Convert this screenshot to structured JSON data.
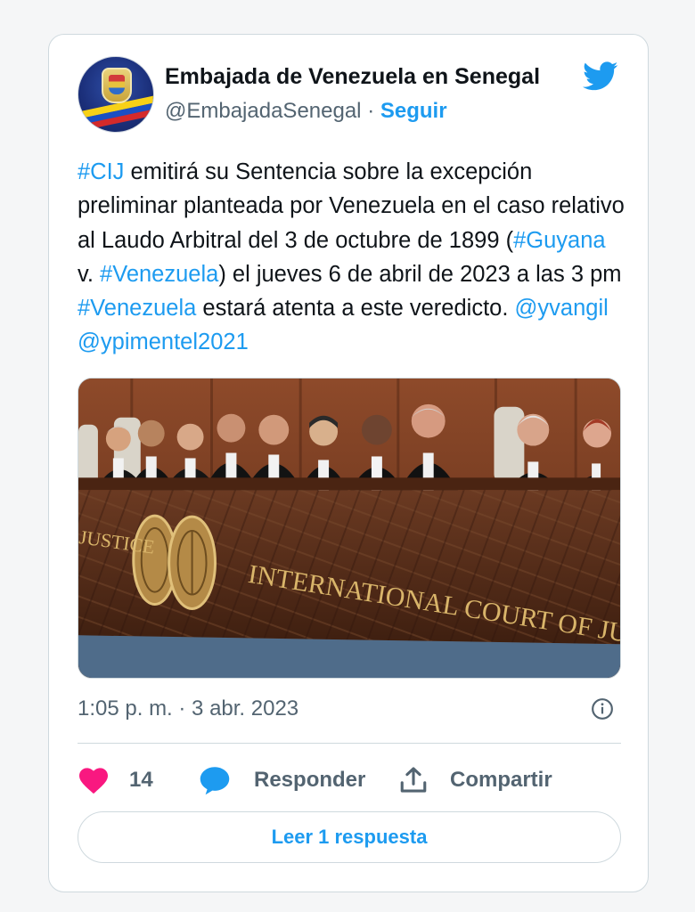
{
  "author": {
    "name": "Embajada de Venezuela en Senegal",
    "handle": "@EmbajadaSenegal",
    "separator": "·",
    "follow_label": "Seguir"
  },
  "tweet": {
    "parts": [
      {
        "text": "#CIJ",
        "tag": true
      },
      {
        "text": " emitirá su Sentencia sobre la excepción preliminar planteada por Venezuela en el caso relativo al Laudo Arbitral del 3 de octubre de 1899 (",
        "tag": false
      },
      {
        "text": "#Guyana",
        "tag": true
      },
      {
        "text": " v. ",
        "tag": false
      },
      {
        "text": "#Venezuela",
        "tag": true
      },
      {
        "text": ") el jueves 6 de abril de 2023 a las 3 pm ",
        "tag": false
      },
      {
        "text": "#Venezuela",
        "tag": true
      },
      {
        "text": " estará atenta a este veredicto. ",
        "tag": false
      },
      {
        "text": "@yvangil",
        "tag": true
      },
      {
        "text": " ",
        "tag": false
      },
      {
        "text": "@ypimentel2021",
        "tag": true
      }
    ]
  },
  "media": {
    "bench_text": "INTERNATIONAL COURT OF JUSTICE",
    "left_text": "JUSTICE"
  },
  "meta": {
    "timestamp": "1:05 p. m. · 3 abr. 2023"
  },
  "actions": {
    "like_count": "14",
    "reply_label": "Responder",
    "share_label": "Compartir"
  },
  "footer": {
    "read_replies_label": "Leer 1 respuesta"
  },
  "colors": {
    "accent": "#1d9bf0",
    "like": "#f91880",
    "muted": "#536471",
    "border": "#cfd9de"
  },
  "icons": [
    "twitter-bird-icon",
    "info-icon",
    "heart-icon",
    "reply-bubble-icon",
    "share-icon"
  ]
}
